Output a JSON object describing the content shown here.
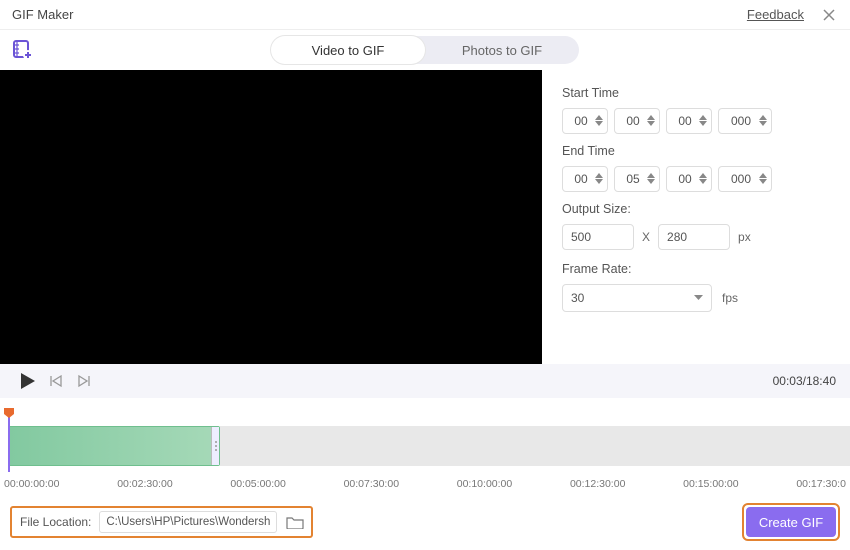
{
  "header": {
    "title": "GIF Maker",
    "feedback": "Feedback"
  },
  "tabs": {
    "video": "Video to GIF",
    "photos": "Photos to GIF"
  },
  "settings": {
    "start_label": "Start Time",
    "end_label": "End Time",
    "start": {
      "h": "00",
      "m": "00",
      "s": "00",
      "ms": "000"
    },
    "end": {
      "h": "00",
      "m": "05",
      "s": "00",
      "ms": "000"
    },
    "output_label": "Output Size:",
    "width": "500",
    "x": "X",
    "height": "280",
    "px": "px",
    "frame_label": "Frame Rate:",
    "frame_value": "30",
    "fps": "fps"
  },
  "playbar": {
    "time": "00:03/18:40"
  },
  "ticks": [
    "00:00:00:00",
    "00:02:30:00",
    "00:05:00:00",
    "00:07:30:00",
    "00:10:00:00",
    "00:12:30:00",
    "00:15:00:00",
    "00:17:30:0"
  ],
  "bottom": {
    "loc_label": "File Location:",
    "loc_path": "C:\\Users\\HP\\Pictures\\Wondersh",
    "create": "Create GIF"
  }
}
